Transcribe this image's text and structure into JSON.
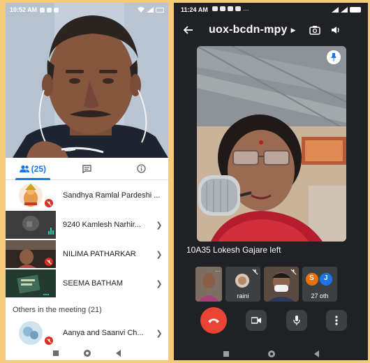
{
  "left_screen": {
    "status_bar": {
      "time": "10:52 AM"
    },
    "tabs": {
      "people_count": "(25)",
      "chat_label": "",
      "info_label": ""
    },
    "participants": [
      {
        "name": "Sandhya Ramlal Pardeshi ...",
        "mic": "off"
      },
      {
        "name": "9240 Kamlesh Narhir...",
        "mic": "on"
      },
      {
        "name": "NILIMA PATHARKAR",
        "mic": "off"
      },
      {
        "name": "SEEMA BATHAM",
        "mic": "on"
      }
    ],
    "others_label": "Others in the meeting (21)",
    "others": [
      {
        "name": "Aanya and Saanvi Ch...",
        "mic": "off"
      }
    ]
  },
  "right_screen": {
    "status_bar": {
      "time": "11:24 AM"
    },
    "meeting_code": "uox-bcdn-mpy",
    "toast": "10A35 Lokesh Gajare left",
    "tiles": [
      {
        "label": "",
        "kind": "self"
      },
      {
        "label": "raini",
        "kind": "person",
        "muted": true
      },
      {
        "label": "",
        "kind": "person",
        "muted": true
      },
      {
        "label": "27 oth",
        "kind": "group",
        "initials": [
          "S",
          "J"
        ]
      }
    ]
  },
  "colors": {
    "background": "#f7c97a",
    "meet_blue": "#1a73e8",
    "end_call_red": "#ea4335",
    "dark_bg": "#202124"
  }
}
